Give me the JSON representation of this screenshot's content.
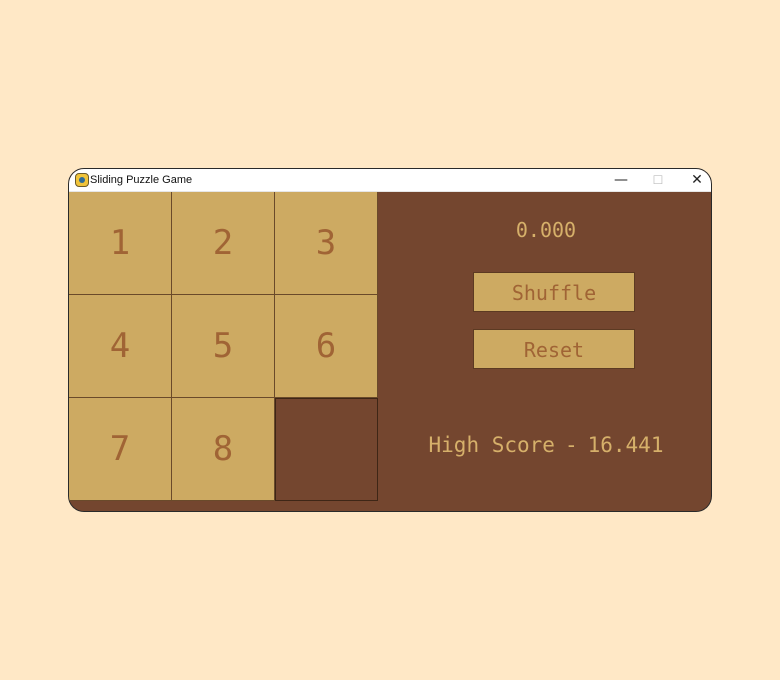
{
  "window": {
    "title": "Sliding Puzzle Game",
    "controls": {
      "minimize": "—",
      "maximize": "☐",
      "close": "✕"
    }
  },
  "board": {
    "tiles": [
      "1",
      "2",
      "3",
      "4",
      "5",
      "6",
      "7",
      "8",
      ""
    ]
  },
  "side": {
    "timer": "0.000",
    "shuffle_label": "Shuffle",
    "reset_label": "Reset",
    "high_score_label": "High Score",
    "high_score_separator": "-",
    "high_score_value": "16.441"
  },
  "colors": {
    "page_background": "#FFE8C6",
    "panel_background": "#74462F",
    "tile_background": "#CDAA62",
    "tile_text": "#A06435",
    "side_text": "#D6B06A"
  },
  "icons": {
    "app": "app-icon"
  }
}
